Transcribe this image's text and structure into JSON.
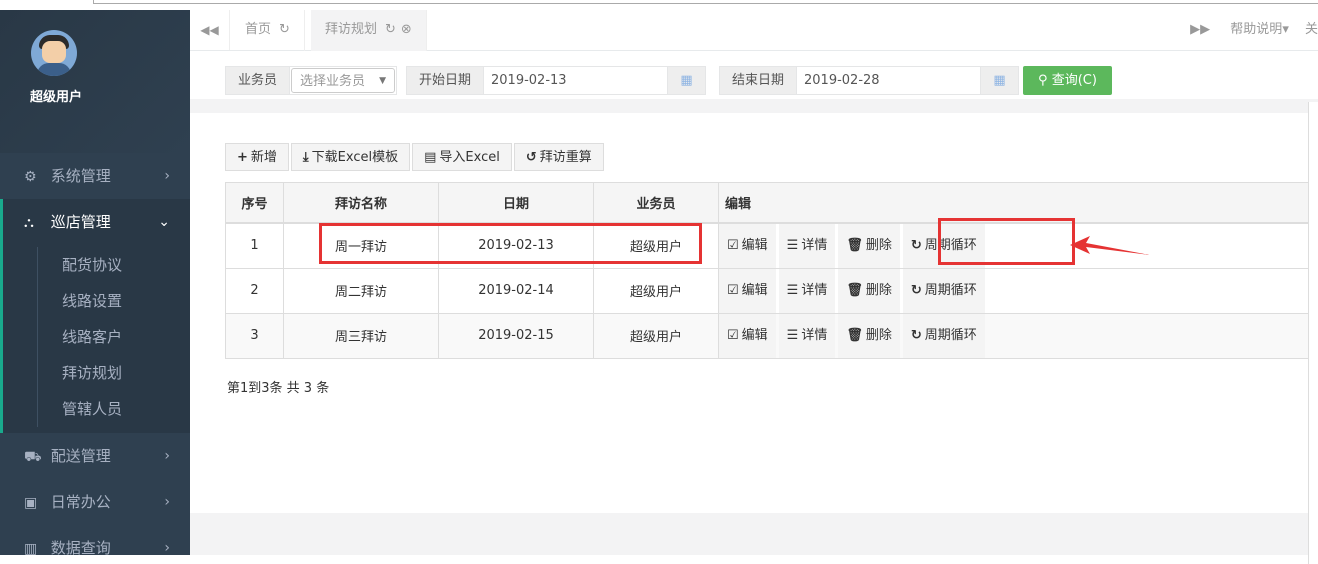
{
  "sidebar": {
    "user_name": "超级用户",
    "items": [
      {
        "label": "系统管理",
        "icon": "gears-icon",
        "glyph": "⚙"
      },
      {
        "label": "巡店管理",
        "icon": "sitemap-icon",
        "glyph": "⛬"
      },
      {
        "label": "配送管理",
        "icon": "truck-icon",
        "glyph": "⛟"
      },
      {
        "label": "日常办公",
        "icon": "briefcase-icon",
        "glyph": "▣"
      },
      {
        "label": "数据查询",
        "icon": "bar-chart-icon",
        "glyph": "▥"
      }
    ],
    "sub_items": [
      "配货协议",
      "线路设置",
      "线路客户",
      "拜访规划",
      "管辖人员"
    ]
  },
  "tabs": {
    "home": "首页",
    "active": "拜访规划",
    "help": "帮助说明",
    "help_caret": "▾",
    "cutoff": "关"
  },
  "filters": {
    "salesman_label": "业务员",
    "salesman_placeholder": "选择业务员",
    "start_label": "开始日期",
    "start_value": "2019-02-13",
    "end_label": "结束日期",
    "end_value": "2019-02-28",
    "query_label": "查询(C)"
  },
  "toolbar": {
    "add": "新增",
    "download_template": "下载Excel模板",
    "import_excel": "导入Excel",
    "recalculate": "拜访重算"
  },
  "table": {
    "headers": [
      "序号",
      "拜访名称",
      "日期",
      "业务员",
      "编辑"
    ],
    "rows": [
      {
        "no": "1",
        "name": "周一拜访",
        "date": "2019-02-13",
        "salesman": "超级用户"
      },
      {
        "no": "2",
        "name": "周二拜访",
        "date": "2019-02-14",
        "salesman": "超级用户"
      },
      {
        "no": "3",
        "name": "周三拜访",
        "date": "2019-02-15",
        "salesman": "超级用户"
      }
    ],
    "actions": {
      "edit": "编辑",
      "detail": "详情",
      "delete": "删除",
      "cycle": "周期循环"
    }
  },
  "pager": {
    "summary": "第1到3条 共 3 条"
  },
  "colors": {
    "sidebar_bg": "#2f4050",
    "accent": "#19aa8d",
    "query_btn": "#5cb85c",
    "highlight": "#e53333"
  }
}
